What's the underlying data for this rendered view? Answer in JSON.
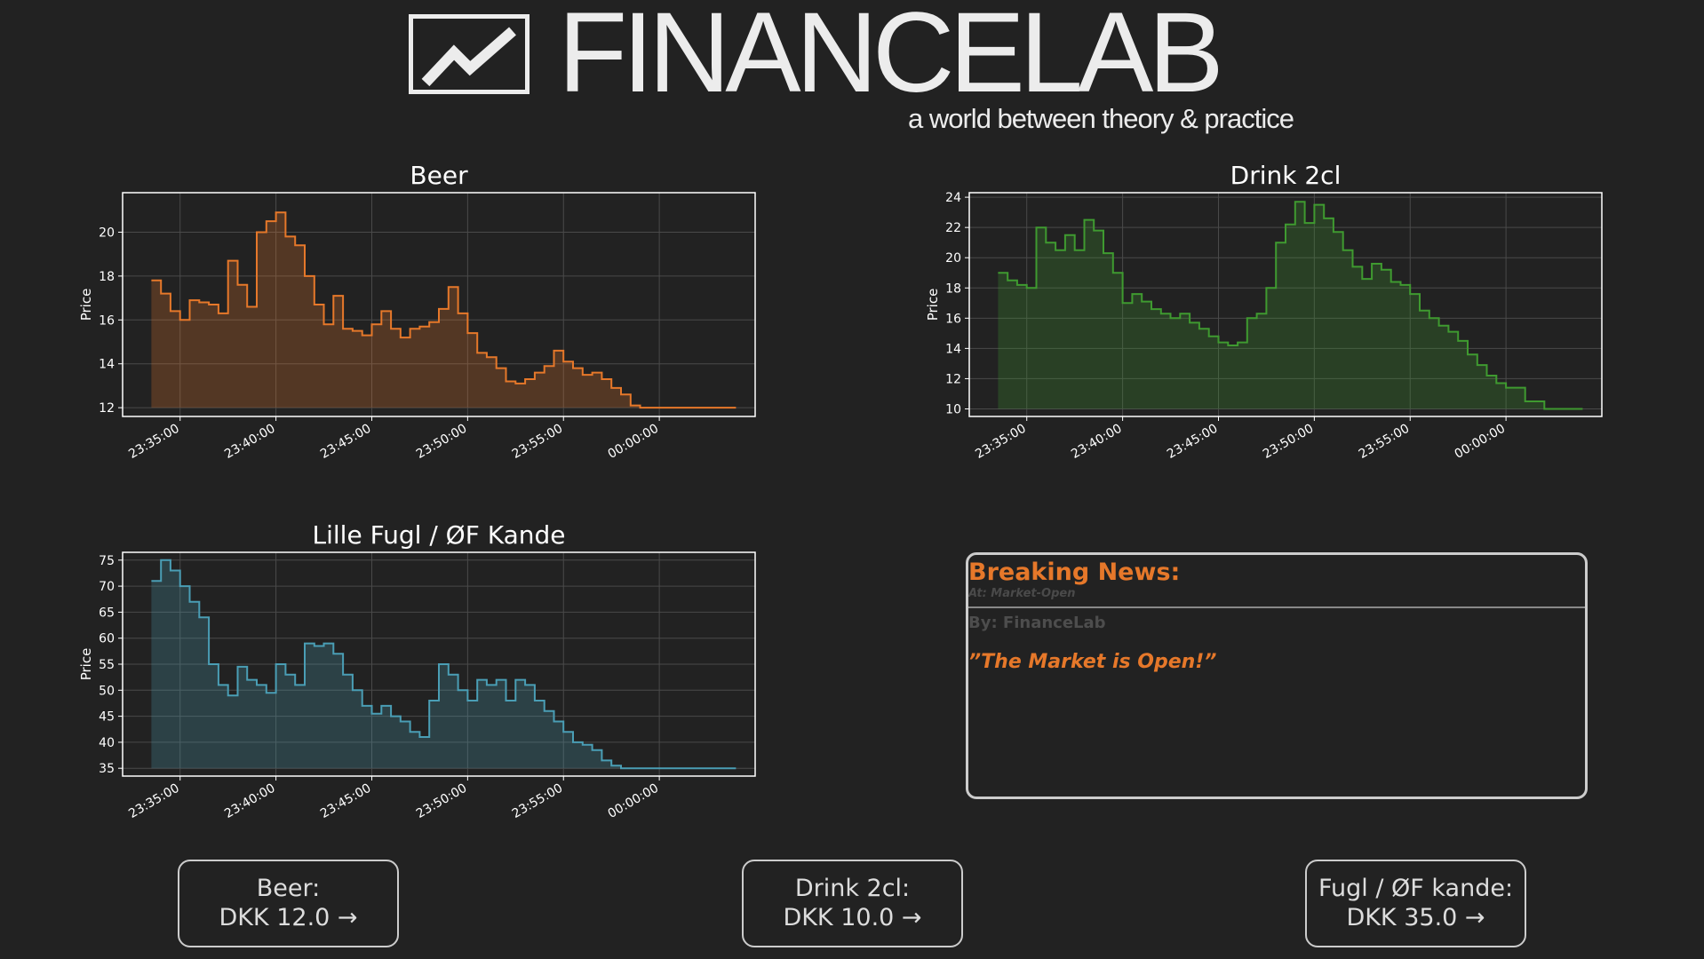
{
  "header": {
    "logo_text": "FINANCELAB",
    "tagline": "a world between theory & practice"
  },
  "chart_data": [
    {
      "type": "area",
      "title": "Beer",
      "ylabel": "Price",
      "xlabel": "",
      "color": "#e6782a",
      "ylim": [
        11.6,
        21.8
      ],
      "yticks": [
        12,
        14,
        16,
        18,
        20
      ],
      "xlim": [
        0,
        33
      ],
      "xticks": [
        {
          "pos": 3,
          "label": "23:35:00"
        },
        {
          "pos": 8,
          "label": "23:40:00"
        },
        {
          "pos": 13,
          "label": "23:45:00"
        },
        {
          "pos": 18,
          "label": "23:50:00"
        },
        {
          "pos": 23,
          "label": "23:55:00"
        },
        {
          "pos": 28,
          "label": "00:00:00"
        }
      ],
      "series": [
        {
          "x": [
            1.5,
            2.0,
            2.5,
            3.0,
            3.5,
            4.0,
            4.5,
            5.0,
            5.5,
            6.0,
            6.5,
            7.0,
            7.5,
            8.0,
            8.5,
            9.0,
            9.5,
            10.0,
            10.5,
            11.0,
            11.5,
            12.0,
            12.5,
            13.0,
            13.5,
            14.0,
            14.5,
            15.0,
            15.5,
            16.0,
            16.5,
            17.0,
            17.5,
            18.0,
            18.5,
            19.0,
            19.5,
            20.0,
            20.5,
            21.0,
            21.5,
            22.0,
            22.5,
            23.0,
            23.5,
            24.0,
            24.5,
            25.0,
            25.5,
            26.0,
            26.5,
            27.0,
            27.5,
            28.0,
            29.0,
            30.0,
            31.0,
            32.0
          ],
          "y": [
            17.8,
            17.2,
            16.4,
            16.0,
            16.9,
            16.8,
            16.7,
            16.3,
            18.7,
            17.6,
            16.6,
            20.0,
            20.5,
            20.9,
            19.8,
            19.4,
            18.0,
            16.7,
            15.8,
            17.1,
            15.6,
            15.5,
            15.3,
            15.8,
            16.4,
            15.6,
            15.2,
            15.6,
            15.7,
            15.9,
            16.5,
            17.5,
            16.3,
            15.4,
            14.5,
            14.3,
            13.8,
            13.2,
            13.1,
            13.3,
            13.6,
            13.9,
            14.6,
            14.1,
            13.8,
            13.5,
            13.6,
            13.3,
            12.9,
            12.6,
            12.1,
            12.0,
            12.0,
            12.0,
            12.0,
            12.0,
            12.0,
            12.0
          ]
        }
      ]
    },
    {
      "type": "area",
      "title": "Drink 2cl",
      "ylabel": "Price",
      "xlabel": "",
      "color": "#3f9a30",
      "ylim": [
        9.5,
        24.3
      ],
      "yticks": [
        10,
        12,
        14,
        16,
        18,
        20,
        22,
        24
      ],
      "xlim": [
        0,
        33
      ],
      "xticks": [
        {
          "pos": 3,
          "label": "23:35:00"
        },
        {
          "pos": 8,
          "label": "23:40:00"
        },
        {
          "pos": 13,
          "label": "23:45:00"
        },
        {
          "pos": 18,
          "label": "23:50:00"
        },
        {
          "pos": 23,
          "label": "23:55:00"
        },
        {
          "pos": 28,
          "label": "00:00:00"
        }
      ],
      "series": [
        {
          "x": [
            1.5,
            2.0,
            2.5,
            3.0,
            3.5,
            4.0,
            4.5,
            5.0,
            5.5,
            6.0,
            6.5,
            7.0,
            7.5,
            8.0,
            8.5,
            9.0,
            9.5,
            10.0,
            10.5,
            11.0,
            11.5,
            12.0,
            12.5,
            13.0,
            13.5,
            14.0,
            14.5,
            15.0,
            15.5,
            16.0,
            16.5,
            17.0,
            17.5,
            18.0,
            18.5,
            19.0,
            19.5,
            20.0,
            20.5,
            21.0,
            21.5,
            22.0,
            22.5,
            23.0,
            23.5,
            24.0,
            24.5,
            25.0,
            25.5,
            26.0,
            26.5,
            27.0,
            27.5,
            28.0,
            29.0,
            30.0,
            31.0,
            32.0
          ],
          "y": [
            19.0,
            18.5,
            18.2,
            18.0,
            22.0,
            21.0,
            20.5,
            21.5,
            20.5,
            22.5,
            21.8,
            20.3,
            19.0,
            17.0,
            17.6,
            17.1,
            16.6,
            16.3,
            16.0,
            16.3,
            15.7,
            15.3,
            14.8,
            14.4,
            14.2,
            14.4,
            16.0,
            16.3,
            18.0,
            21.0,
            22.2,
            23.7,
            22.3,
            23.5,
            22.6,
            21.7,
            20.5,
            19.4,
            18.6,
            19.6,
            19.2,
            18.4,
            18.2,
            17.6,
            16.5,
            16.0,
            15.5,
            15.1,
            14.5,
            13.6,
            12.9,
            12.2,
            11.7,
            11.4,
            10.5,
            10.0,
            10.0,
            10.0
          ]
        }
      ]
    },
    {
      "type": "area",
      "title": "Lille Fugl / ØF Kande",
      "ylabel": "Price",
      "xlabel": "",
      "color": "#4a9eb5",
      "ylim": [
        33.5,
        76.5
      ],
      "yticks": [
        35,
        40,
        45,
        50,
        55,
        60,
        65,
        70,
        75
      ],
      "xlim": [
        0,
        33
      ],
      "xticks": [
        {
          "pos": 3,
          "label": "23:35:00"
        },
        {
          "pos": 8,
          "label": "23:40:00"
        },
        {
          "pos": 13,
          "label": "23:45:00"
        },
        {
          "pos": 18,
          "label": "23:50:00"
        },
        {
          "pos": 23,
          "label": "23:55:00"
        },
        {
          "pos": 28,
          "label": "00:00:00"
        }
      ],
      "series": [
        {
          "x": [
            1.5,
            2.0,
            2.5,
            3.0,
            3.5,
            4.0,
            4.5,
            5.0,
            5.5,
            6.0,
            6.5,
            7.0,
            7.5,
            8.0,
            8.5,
            9.0,
            9.5,
            10.0,
            10.5,
            11.0,
            11.5,
            12.0,
            12.5,
            13.0,
            13.5,
            14.0,
            14.5,
            15.0,
            15.5,
            16.0,
            16.5,
            17.0,
            17.5,
            18.0,
            18.5,
            19.0,
            19.5,
            20.0,
            20.5,
            21.0,
            21.5,
            22.0,
            22.5,
            23.0,
            23.5,
            24.0,
            24.5,
            25.0,
            25.5,
            26.0,
            26.5,
            27.0,
            27.5,
            28.0,
            29.0,
            30.0,
            31.0,
            32.0
          ],
          "y": [
            71.0,
            75.0,
            73.0,
            70.0,
            67.0,
            64.0,
            55.0,
            51.0,
            49.0,
            54.5,
            52.0,
            51.0,
            49.5,
            55.0,
            53.0,
            51.0,
            59.0,
            58.5,
            59.0,
            57.0,
            53.0,
            50.0,
            47.0,
            45.5,
            47.0,
            45.0,
            44.0,
            42.0,
            41.0,
            48.0,
            55.0,
            53.0,
            50.0,
            48.0,
            52.0,
            51.0,
            52.0,
            48.0,
            52.0,
            51.0,
            48.0,
            46.0,
            44.0,
            42.0,
            40.0,
            39.5,
            38.5,
            36.5,
            35.5,
            35.0,
            35.0,
            35.0,
            35.0,
            35.0,
            35.0,
            35.0,
            35.0,
            35.0
          ]
        }
      ]
    }
  ],
  "news": {
    "title": "Breaking News:",
    "at": "At: Market-Open",
    "by": "By: FinanceLab",
    "quote": "”The Market is Open!”"
  },
  "prices": [
    {
      "line1": "Beer:",
      "line2": "DKK 12.0 →"
    },
    {
      "line1": "Drink 2cl:",
      "line2": "DKK 10.0 →"
    },
    {
      "line1": "Fugl / ØF kande:",
      "line2": "DKK 35.0 →"
    }
  ]
}
